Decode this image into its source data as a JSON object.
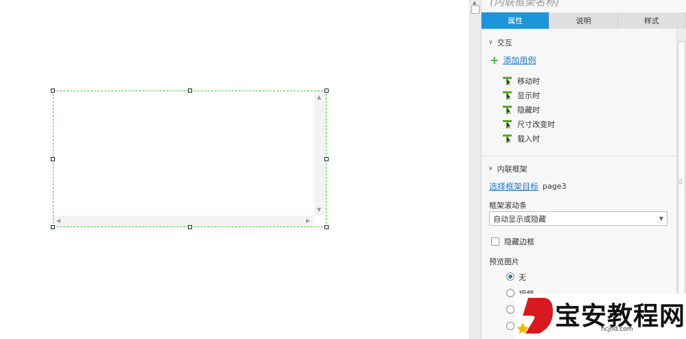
{
  "panel": {
    "title": "(内联框架名称)",
    "tabs": [
      {
        "label": "属性",
        "active": true
      },
      {
        "label": "说明",
        "active": false
      },
      {
        "label": "样式",
        "active": false
      }
    ],
    "interaction": {
      "section_label": "交互",
      "add_case_label": "添加用例",
      "events": [
        "移动时",
        "显示时",
        "隐藏时",
        "尺寸改变时",
        "载入时"
      ]
    },
    "iframe": {
      "section_label": "内联框架",
      "choose_target_label": "选择框架目标",
      "target_value": "page3",
      "scrollbar_label": "框架滚动条",
      "scrollbar_value": "自动显示或隐藏",
      "hide_border_label": "隐藏边框",
      "hide_border_checked": false,
      "preview_label": "预览图片",
      "preview_options": [
        {
          "label": "无",
          "selected": true
        },
        {
          "label": "视频",
          "selected": false
        },
        {
          "label": "",
          "selected": false
        },
        {
          "label": "",
          "selected": false
        }
      ]
    }
  },
  "colors": {
    "accent": "#1f94d9",
    "selection_border": "#3fbf3f",
    "link": "#1f78c8",
    "event_icon": "#5aaa2a"
  },
  "watermark": {
    "text": "宝安教程网",
    "url": "hcjhd.com"
  }
}
